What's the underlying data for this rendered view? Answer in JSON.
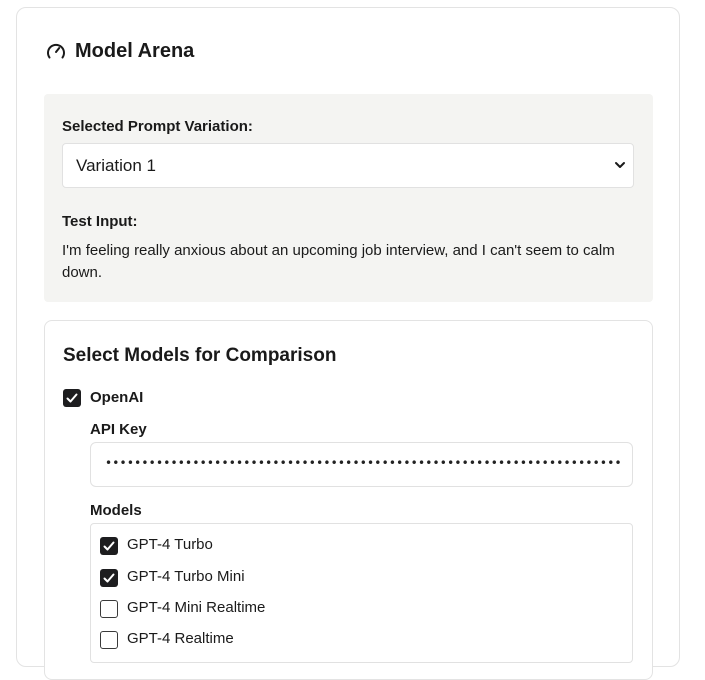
{
  "header": {
    "title": "Model Arena",
    "icon": "gauge-icon"
  },
  "prompt": {
    "selected_label": "Selected Prompt Variation:",
    "selected_value": "Variation 1",
    "test_input_label": "Test Input:",
    "test_input_text": "I'm feeling really anxious about an upcoming job interview, and I can't seem to calm down."
  },
  "comparison": {
    "title": "Select Models for Comparison",
    "provider": {
      "name": "OpenAI",
      "checked": true,
      "api_key_label": "API Key",
      "api_key_masked": "••••••••••••••••••••••••••••••••••••••••••••••••••••••••••••••••••••••••••••••••••••••",
      "models_label": "Models",
      "models": [
        {
          "name": "GPT-4 Turbo",
          "checked": true
        },
        {
          "name": "GPT-4 Turbo Mini",
          "checked": true
        },
        {
          "name": "GPT-4 Mini Realtime",
          "checked": false
        },
        {
          "name": "GPT-4 Realtime",
          "checked": false
        }
      ]
    }
  },
  "colors": {
    "checkbox_fill": "#1d1d1f",
    "panel_bg": "#f4f4f2",
    "border": "#e3e3e3"
  }
}
